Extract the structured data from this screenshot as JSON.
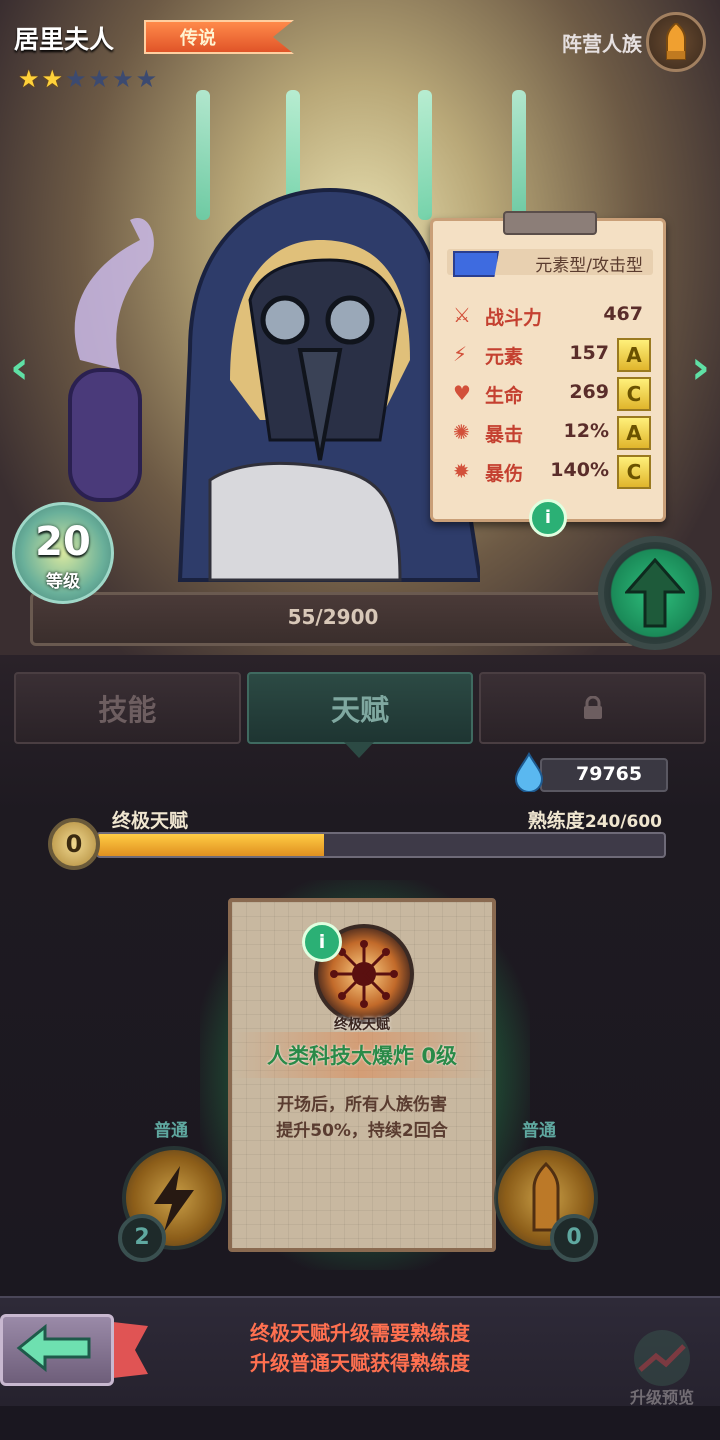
{
  "character": {
    "name": "居里夫人",
    "rarity": "传说",
    "stars_filled": 2,
    "stars_total": 6,
    "faction_label": "阵营人族",
    "faction_icon": "bullet-icon"
  },
  "stats": {
    "type_label": "元素型/攻击型",
    "rows": [
      {
        "icon": "swords-icon",
        "label": "战斗力",
        "value": "467",
        "grade": ""
      },
      {
        "icon": "lightning-icon",
        "label": "元素",
        "value": "157",
        "grade": "A"
      },
      {
        "icon": "heart-icon",
        "label": "生命",
        "value": "269",
        "grade": "C"
      },
      {
        "icon": "crit-icon",
        "label": "暴击",
        "value": "12%",
        "grade": "A"
      },
      {
        "icon": "critdmg-icon",
        "label": "暴伤",
        "value": "140%",
        "grade": "C"
      }
    ],
    "info": "i"
  },
  "level": {
    "value": "20",
    "label": "等级",
    "xp_text": "55/2900",
    "xp_fraction": 0.019
  },
  "tabs": [
    {
      "label": "技能",
      "active": false
    },
    {
      "label": "天赋",
      "active": true
    },
    {
      "label": "",
      "locked": true
    }
  ],
  "currency": {
    "value": "79765",
    "icon": "water-drop-icon"
  },
  "ultimate": {
    "title": "终极天赋",
    "level": "0",
    "proficiency_label": "熟练度",
    "proficiency_value": "240/600",
    "progress": 0.4
  },
  "talent_card": {
    "info": "i",
    "type": "终极天赋",
    "name": "人类科技大爆炸 0级",
    "description_line1": "开场后，所有人族伤害",
    "description_line2": "提升50%，持续2回合"
  },
  "side_talents": [
    {
      "label": "普通",
      "icon": "lightning-icon",
      "count": "2"
    },
    {
      "label": "普通",
      "icon": "bullet-icon",
      "count": "0"
    }
  ],
  "hint": {
    "line1": "终极天赋升级需要熟练度",
    "line2": "升级普通天赋获得熟练度"
  },
  "preview_label": "升级预览",
  "colors": {
    "accent_green": "#2bb075",
    "rarity_orange": "#e05428",
    "hint_red": "#ff7050",
    "progress_gold": "#ffcc44"
  }
}
